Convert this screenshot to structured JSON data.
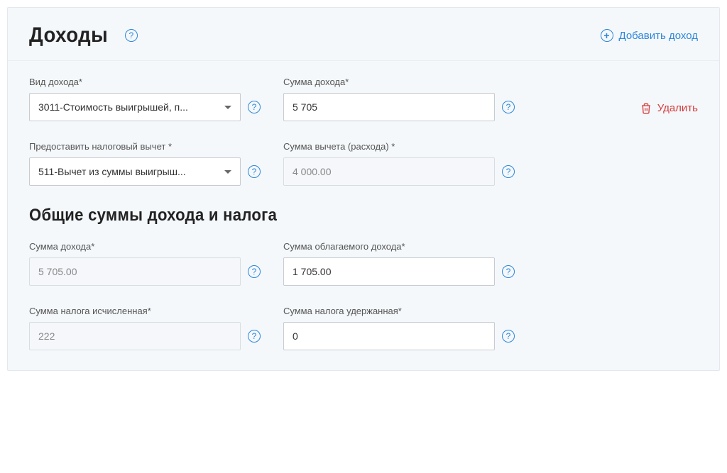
{
  "header": {
    "title": "Доходы",
    "add_label": "Добавить доход"
  },
  "income": {
    "type_label": "Вид дохода*",
    "type_value": "3011-Стоимость выигрышей, п...",
    "amount_label": "Сумма дохода*",
    "amount_value": "5 705",
    "delete_label": "Удалить",
    "deduction_label": "Предоставить налоговый вычет *",
    "deduction_value": "511-Вычет из суммы выигрыш...",
    "deduction_amount_label": "Сумма вычета (расхода) *",
    "deduction_amount_value": "4 000.00"
  },
  "totals": {
    "section_title": "Общие суммы дохода и налога",
    "income_sum_label": "Сумма дохода*",
    "income_sum_value": "5 705.00",
    "taxable_label": "Сумма облагаемого дохода*",
    "taxable_value": "1 705.00",
    "tax_calc_label": "Сумма налога исчисленная*",
    "tax_calc_value": "222",
    "tax_withheld_label": "Сумма налога удержанная*",
    "tax_withheld_value": "0"
  }
}
